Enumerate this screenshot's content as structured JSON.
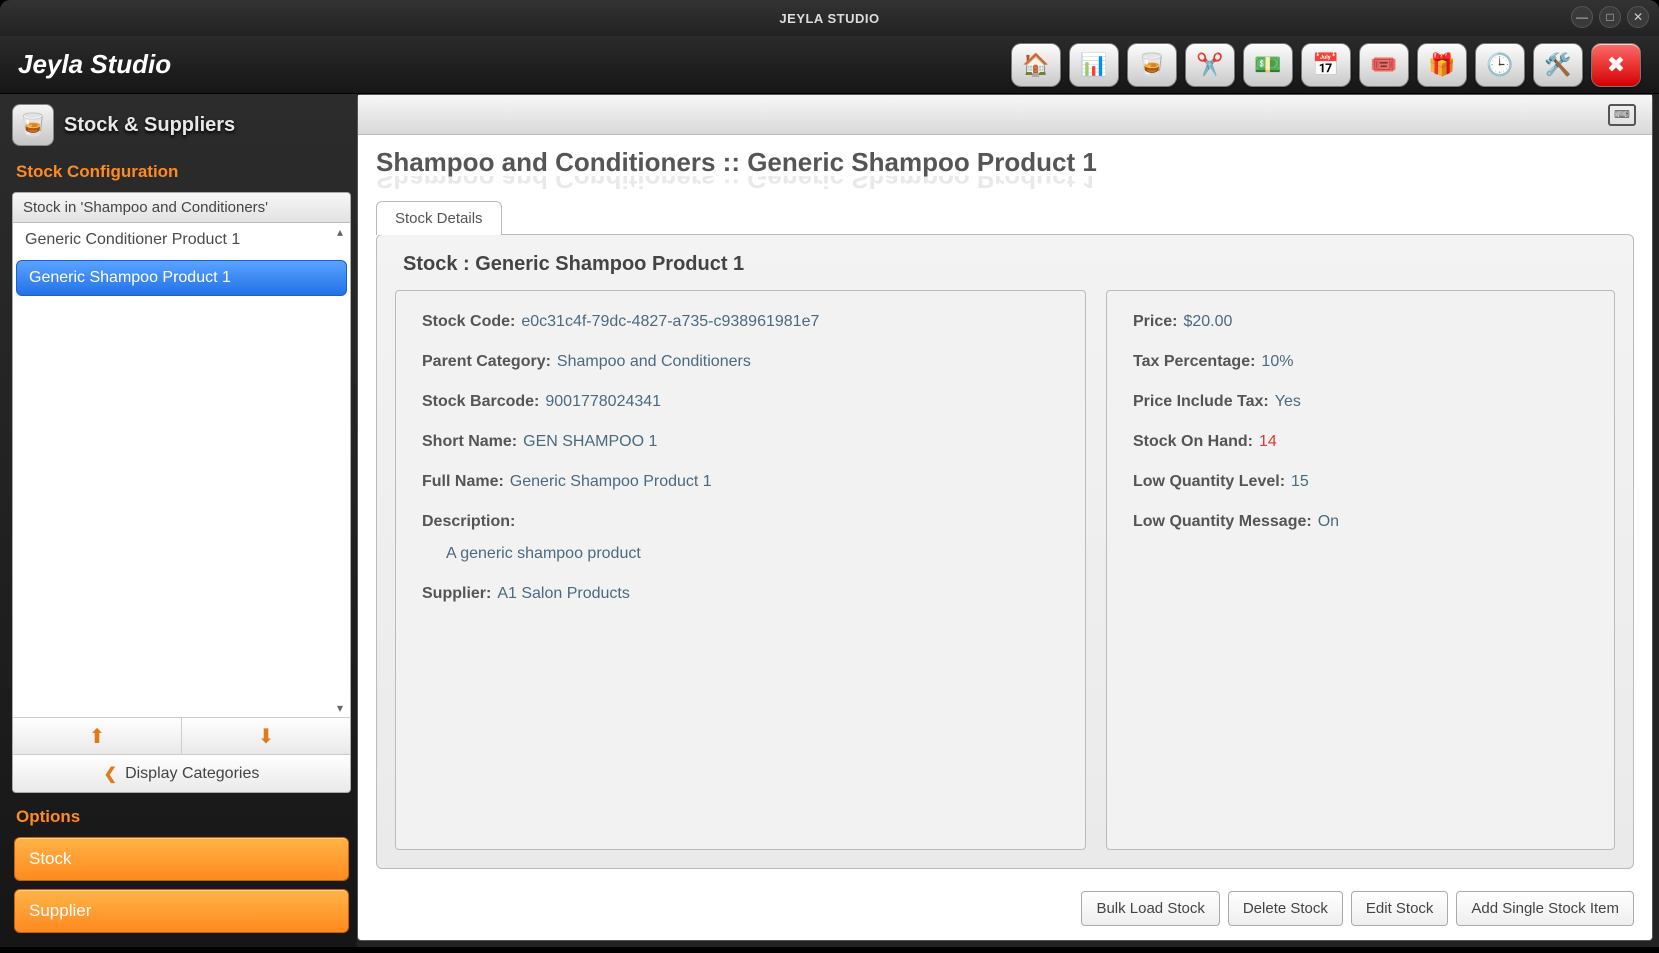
{
  "window_title": "JEYLA STUDIO",
  "brand": "Jeyla Studio",
  "sidebar": {
    "module_title": "Stock & Suppliers",
    "config_label": "Stock Configuration",
    "list_header": "Stock in 'Shampoo and Conditioners'",
    "items": [
      {
        "label": "Generic Conditioner Product 1",
        "selected": false
      },
      {
        "label": "Generic Shampoo Product 1",
        "selected": true
      }
    ],
    "display_categories": "Display Categories",
    "options_label": "Options",
    "option_buttons": [
      "Stock",
      "Supplier"
    ]
  },
  "main": {
    "breadcrumb": "Shampoo and Conditioners :: Generic Shampoo Product 1",
    "tab_label": "Stock Details",
    "detail_title": "Stock : Generic Shampoo Product 1",
    "left": {
      "stock_code_label": "Stock Code:",
      "stock_code": "e0c31c4f-79dc-4827-a735-c938961981e7",
      "parent_cat_label": "Parent Category:",
      "parent_cat": "Shampoo and Conditioners",
      "barcode_label": "Stock Barcode:",
      "barcode": "9001778024341",
      "short_name_label": "Short Name:",
      "short_name": "GEN SHAMPOO 1",
      "full_name_label": "Full Name:",
      "full_name": "Generic Shampoo Product 1",
      "desc_label": "Description:",
      "desc": "A generic shampoo product",
      "supplier_label": "Supplier:",
      "supplier": "A1 Salon Products"
    },
    "right": {
      "price_label": "Price:",
      "price": "$20.00",
      "tax_label": "Tax Percentage:",
      "tax": "10%",
      "inc_tax_label": "Price Include Tax:",
      "inc_tax": "Yes",
      "soh_label": "Stock On Hand:",
      "soh": "14",
      "lowq_label": "Low Quantity Level:",
      "lowq": "15",
      "lowmsg_label": "Low Quantity Message:",
      "lowmsg": "On"
    },
    "actions": [
      "Bulk Load Stock",
      "Delete Stock",
      "Edit Stock",
      "Add Single Stock Item"
    ]
  }
}
